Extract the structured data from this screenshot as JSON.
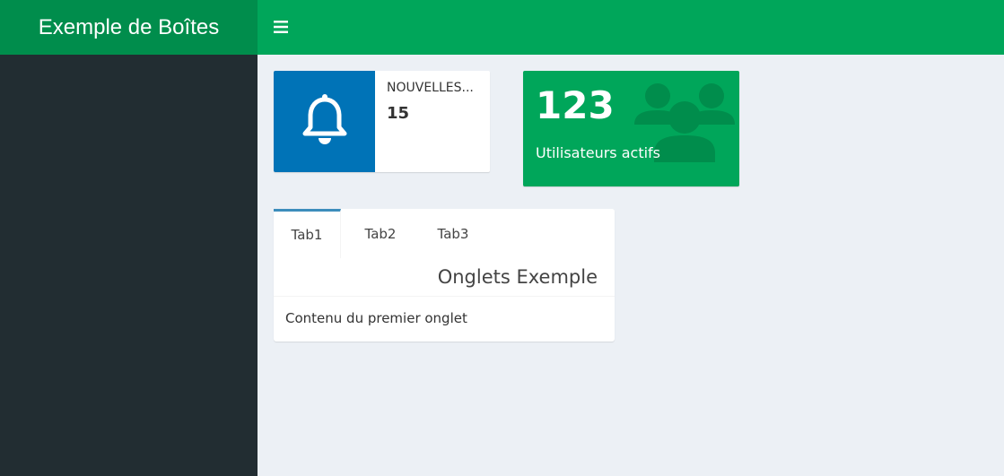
{
  "header": {
    "title": "Exemple de Boîtes",
    "menu_icon": "hamburger-icon"
  },
  "info_box": {
    "text": "NOUVELLES...",
    "number": "15",
    "icon": "bell-icon",
    "icon_bg": "#0073b7"
  },
  "value_box": {
    "number": "123",
    "label": "Utilisateurs actifs",
    "icon": "users-icon",
    "bg": "#00a65a"
  },
  "tabs": {
    "items": [
      {
        "label": "Tab1",
        "active": true
      },
      {
        "label": "Tab2",
        "active": false
      },
      {
        "label": "Tab3",
        "active": false
      }
    ],
    "title": "Onglets Exemple",
    "content": "Contenu du premier onglet"
  },
  "colors": {
    "logo_bg": "#008d4c",
    "topbar_bg": "#00a65a",
    "sidebar_bg": "#222d32",
    "body_bg": "#ecf0f5"
  }
}
